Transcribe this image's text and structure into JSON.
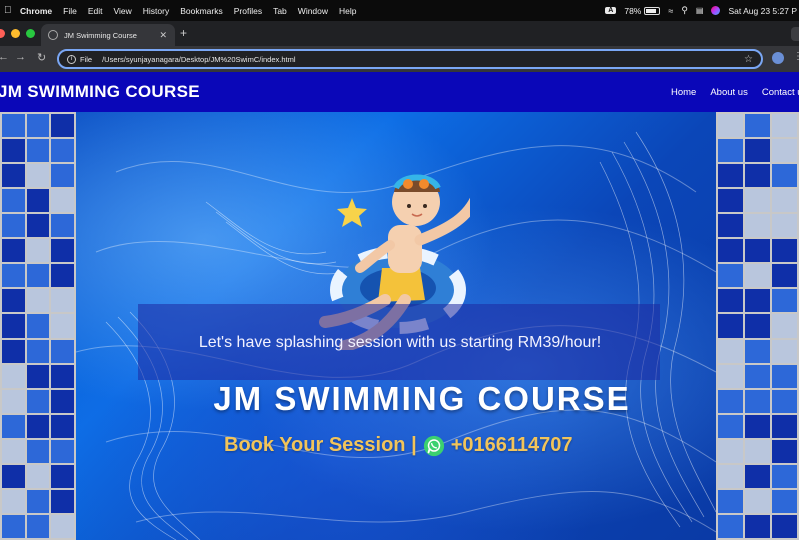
{
  "menubar": {
    "items": [
      "Chrome",
      "File",
      "Edit",
      "View",
      "History",
      "Bookmarks",
      "Profiles",
      "Tab",
      "Window",
      "Help"
    ],
    "input_badge": "A",
    "battery": "78%",
    "battery_level": 0.78,
    "datetime": "Sat Aug 23  5:27 P"
  },
  "browser": {
    "tab_title": "JM Swimming Course",
    "scheme_label": "File",
    "url": "/Users/syunjayanagara/Desktop/JM%20SwimC/index.html",
    "colors": {
      "frame": "#202124",
      "toolbar": "#35363a",
      "omnibox_focus": "#7aa7f5"
    }
  },
  "site": {
    "brand": "JM SWIMMING COURSE",
    "nav": {
      "home": "Home",
      "about": "About us",
      "contact": "Contact u"
    },
    "hero": {
      "tagline": "Let's have splashing session with us starting RM39/hour!",
      "title": "JM SWIMMING COURSE",
      "book_text": "Book Your Session |",
      "phone": "+0166114707"
    },
    "colors": {
      "nav_bg": "#0a07b8",
      "book_text": "#f2c45a",
      "tile_dark": "#0f2fa8",
      "tile_mid": "#2d68d8",
      "tile_light": "#b9c6dd"
    }
  }
}
